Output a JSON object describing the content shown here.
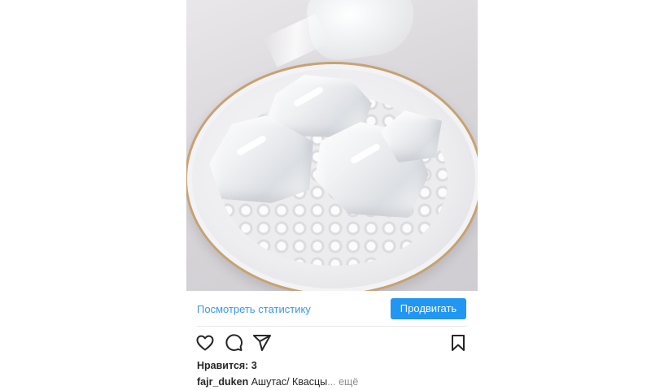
{
  "post": {
    "image": {
      "alt_semantic": "photo"
    },
    "stats_link_label": "Посмотреть статистику",
    "promote_button_label": "Продвигать",
    "likes_text": "Нравится: 3",
    "caption": {
      "username": "fajr_duken",
      "text": "Ашутас/ Квасцы",
      "more_label": "... ещё"
    },
    "icons": [
      "heart-icon",
      "comment-icon",
      "share-icon",
      "bookmark-icon"
    ]
  },
  "colors": {
    "link": "#3897f0",
    "button": "#2196f3",
    "text": "#262626",
    "muted": "#8e8e8e"
  }
}
